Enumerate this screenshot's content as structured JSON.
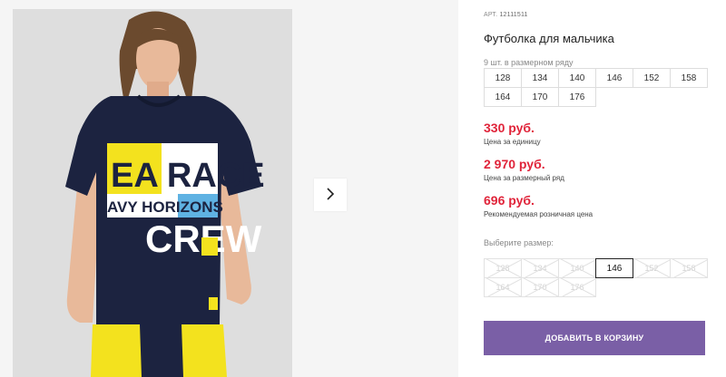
{
  "product": {
    "article_label": "АРТ.",
    "article_number": "12111511",
    "title": "Футболка для мальчика",
    "photo_shirt_text": {
      "line1": "EA RACE",
      "line2": "AVY HORIZONS",
      "line3": "CREW"
    }
  },
  "size_row": {
    "note": "9 шт. в размерном ряду",
    "sizes": [
      "128",
      "134",
      "140",
      "146",
      "152",
      "158",
      "164",
      "170",
      "176"
    ]
  },
  "prices": [
    {
      "value": "330 руб.",
      "label": "Цена за единицу"
    },
    {
      "value": "2 970 руб.",
      "label": "Цена за размерный ряд"
    },
    {
      "value": "696 руб.",
      "label": "Рекомендуемая розничная цена"
    }
  ],
  "size_picker": {
    "label": "Выберите размер:",
    "options": [
      "128",
      "134",
      "140",
      "146",
      "152",
      "158",
      "164",
      "170",
      "176"
    ],
    "selected": "146"
  },
  "cart_button_label": "ДОБАВИТЬ В КОРЗИНУ",
  "colors": {
    "price_red": "#e0243a",
    "button_purple": "#7a5fa6",
    "shirt_navy": "#1c2340",
    "pants_yellow": "#f3e21e"
  },
  "icons": {
    "next": "chevron-right-icon"
  }
}
